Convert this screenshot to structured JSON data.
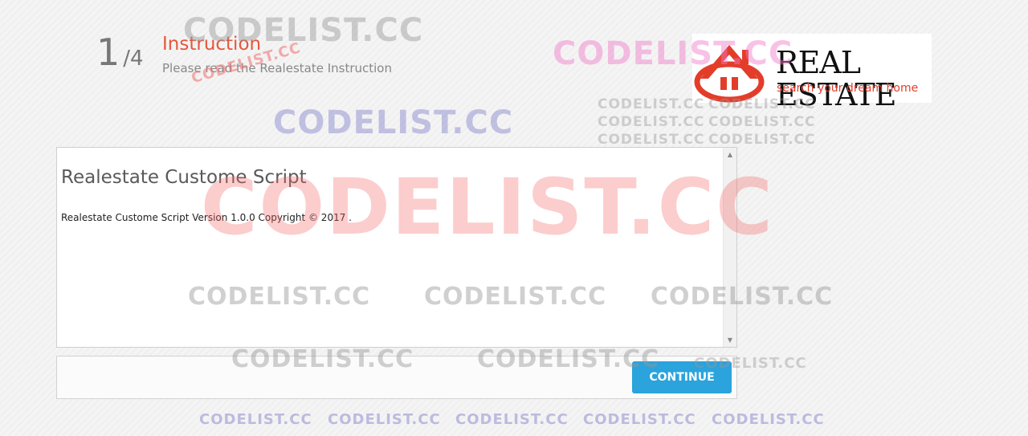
{
  "step": {
    "current": "1",
    "total": "/4",
    "title": "Instruction",
    "subtitle": "Please read the Realestate Instruction"
  },
  "logo": {
    "title": "REAL ESTATE",
    "tagline": "search your dream home"
  },
  "panel": {
    "heading": "Realestate Custome Script",
    "text": "Realestate Custome Script Version 1.0.0 Copyright © 2017 ."
  },
  "footer": {
    "continue_label": "CONTINUE"
  },
  "watermark": {
    "text": "CODELIST.CC"
  },
  "colors": {
    "accent": "#e4573b",
    "button": "#2ba3dc",
    "logo_red": "#e33d2a"
  },
  "icons": {
    "logo": "house-roof-icon",
    "scroll_up": "scroll-up-arrow-icon",
    "scroll_down": "scroll-down-arrow-icon"
  }
}
